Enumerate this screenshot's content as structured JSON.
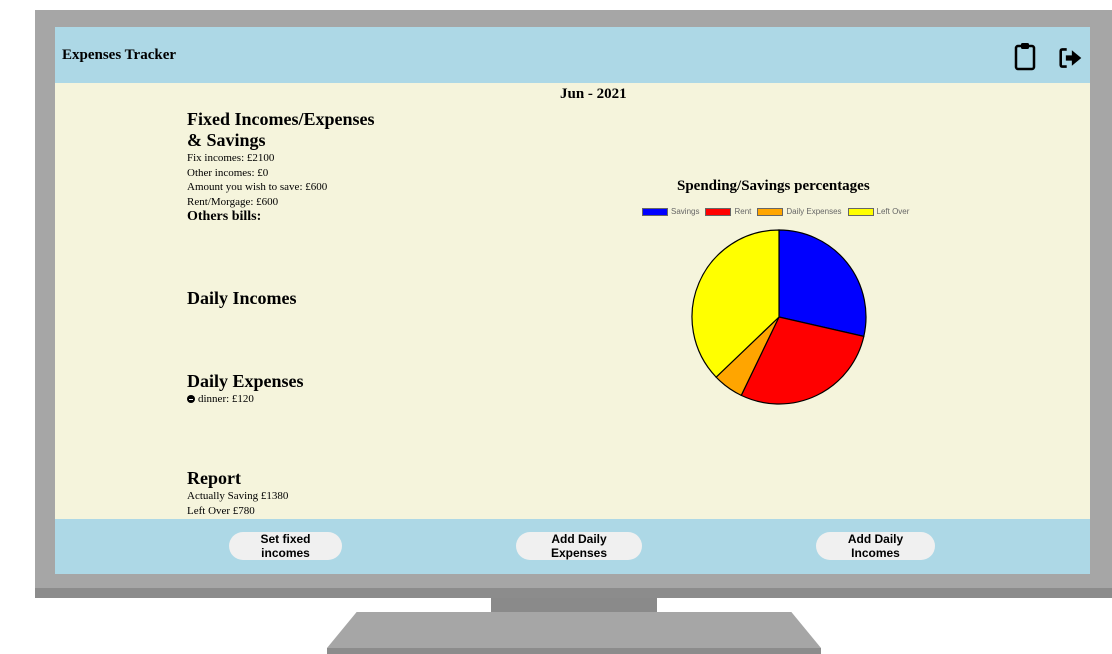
{
  "header": {
    "title": "Expenses Tracker",
    "icons": [
      "clipboard-icon",
      "sign-out-icon"
    ]
  },
  "month": "Jun - 2021",
  "fixed": {
    "title_line1": "Fixed Incomes/Expenses",
    "title_line2": "& Savings",
    "fix_incomes": "Fix incomes: £2100",
    "other_incomes": "Other incomes: £0",
    "wish_save": "Amount you wish to save: £600",
    "rent": "Rent/Morgage: £600",
    "others_bills": "Others bills:"
  },
  "daily_incomes": {
    "title": "Daily Incomes"
  },
  "daily_expenses": {
    "title": "Daily Expenses",
    "items": [
      {
        "label": "dinner: £120",
        "icon": "minus-circle-icon"
      }
    ]
  },
  "report": {
    "title": "Report",
    "saving": "Actually Saving £1380",
    "left_over": "Left Over £780"
  },
  "chart_data": {
    "type": "pie",
    "title": "Spending/Savings percentages",
    "legend_position": "top",
    "categories": [
      "Savings",
      "Rent",
      "Daily Expenses",
      "Left Over"
    ],
    "values": [
      600,
      600,
      120,
      780
    ],
    "colors": [
      "#0000ff",
      "#ff0000",
      "#ffa500",
      "#ffff00"
    ]
  },
  "footer": {
    "set_fixed": "Set fixed incomes",
    "add_expenses": "Add Daily Expenses",
    "add_incomes": "Add Daily Incomes"
  },
  "colors": {
    "bar": "#add8e6",
    "background": "#f5f4dc"
  }
}
